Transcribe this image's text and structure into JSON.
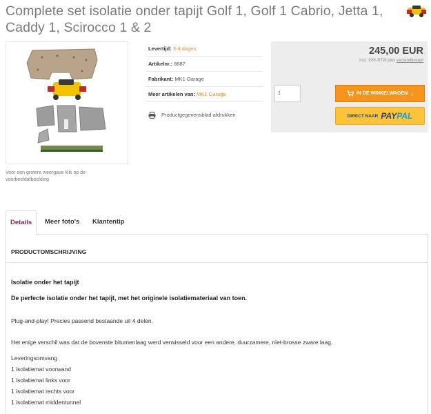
{
  "product": {
    "title": "Complete set isolatie onder tapijt Golf 1, Golf 1 Cabrio, Jetta 1, Caddy 1, Scirocco 1 & 2",
    "image_note": "Voor een grotere weergave klik op de voorbeeldafbeelding"
  },
  "attributes": [
    {
      "key": "Levertijd:",
      "value": "3-4 dagen",
      "link": true
    },
    {
      "key": "Artikelnr.:",
      "value": "8687",
      "link": false
    },
    {
      "key": "Fabrikant:",
      "value": "MK1 Garage",
      "link": false
    },
    {
      "key": "Meer artikelen van:",
      "value": "MK1 Garage",
      "link": true
    }
  ],
  "print_label": "Productgegevensblad afdrukken",
  "buybox": {
    "price": "245,00 EUR",
    "vat_prefix": "incl. 19% BTW plus ",
    "vat_link": "verzendkosten",
    "qty": "1",
    "cart_label": "IN DE WINKELWAGEN",
    "cart_arrow": "›",
    "paypal_prefix": "DIRECT NAAR",
    "paypal_pay": "PAY",
    "paypal_pal": "PAL"
  },
  "tabs": [
    {
      "label": "Details"
    },
    {
      "label": "Meer foto's"
    },
    {
      "label": "Klantentip"
    }
  ],
  "description": {
    "heading": "PRODUCTOMSCHRIJVING",
    "sub1": "Isolatie onder het tapijt",
    "sub2": "De perfecte isolatie onder het tapijt, met het originele isolatiemateriaal van toen.",
    "p1": "Plug-and-play! Precies passend bestaande uit 4 delen.",
    "p2": "Het enige verschil was dat de bovenste bitumenlaag werd verwisseld voor een andere, duurzamere, niet-brosse zware laag.",
    "scope": [
      "Leveringsomvang",
      "1 isolatiemat voorwand",
      "1 isolatiemat links voor",
      "1 isolatiemat  rechts voor",
      "1 isolatiemat middentunnel"
    ]
  },
  "colors": {
    "accent_orange": "#f7941d",
    "tab_active": "#7e2c65",
    "paypal_yellow": "#fec439"
  }
}
